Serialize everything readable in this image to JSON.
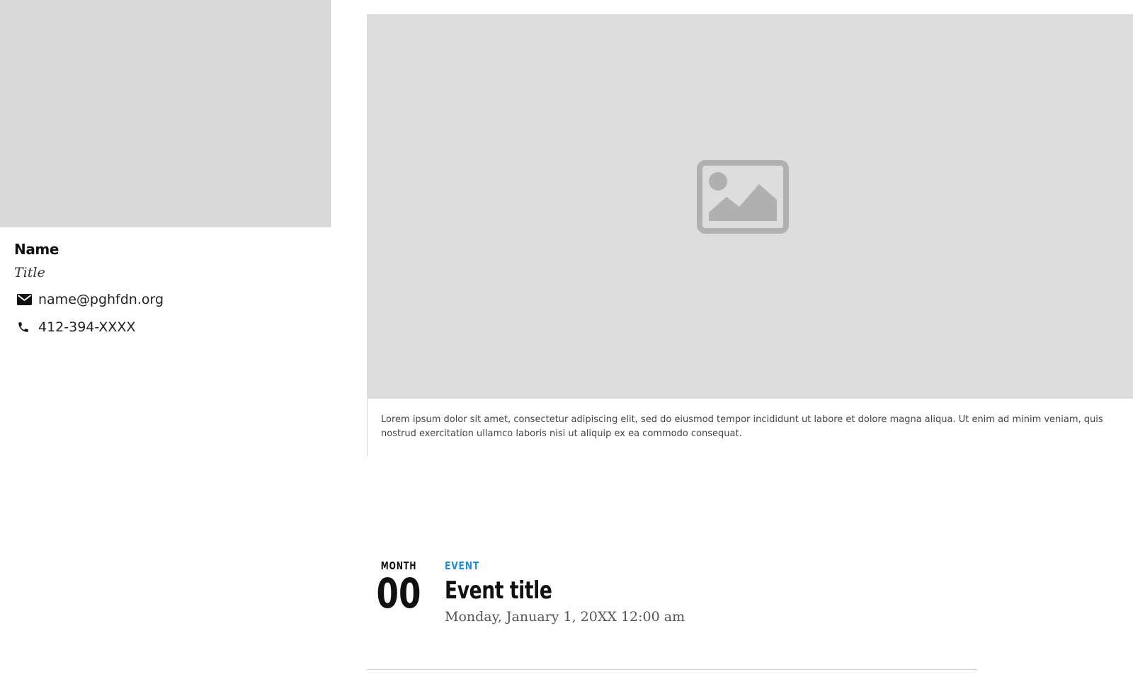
{
  "staff_card": {
    "name": "Name",
    "title": "Title",
    "email": "name@pghfdn.org",
    "phone": "412-394-XXXX",
    "icons": {
      "email": "envelope-icon",
      "phone": "phone-icon"
    }
  },
  "media": {
    "placeholder_icon": "image-placeholder-icon",
    "caption": "Lorem ipsum dolor sit amet, consectetur adipiscing elit, sed do eiusmod tempor incididunt ut labore et dolore magna aliqua. Ut enim ad minim veniam, quis nostrud exercitation ullamco laboris nisi ut aliquip ex ea commodo consequat."
  },
  "event": {
    "month": "MONTH",
    "day": "00",
    "type": "EVENT",
    "title": "Event title",
    "datetime": "Monday, January 1, 20XX 12:00 am"
  },
  "colors": {
    "accent": "#1e8fd9",
    "placeholder_bg": "#dddddd",
    "placeholder_icon": "#b0b0b0"
  }
}
